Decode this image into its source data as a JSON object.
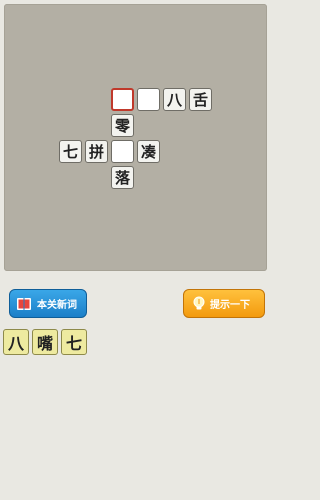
{
  "puzzle": {
    "tiles": {
      "r0c2": "",
      "r0c3": "",
      "r0c4": "八",
      "r0c5": "舌",
      "r1c2": "零",
      "r2c0": "七",
      "r2c1": "拼",
      "r2c2": "",
      "r2c3": "凑",
      "r3c2": "落"
    }
  },
  "toolbar": {
    "new_words_label": "本关新词",
    "hint_label": "提示一下"
  },
  "candidates": [
    "八",
    "嘴",
    "七"
  ],
  "colors": {
    "board": "#b3afa4",
    "selected_border": "#c0392b",
    "new_words_button": "#1c7fc8",
    "hint_button": "#f39a0e",
    "candidate_tile": "#eeeaa0"
  }
}
